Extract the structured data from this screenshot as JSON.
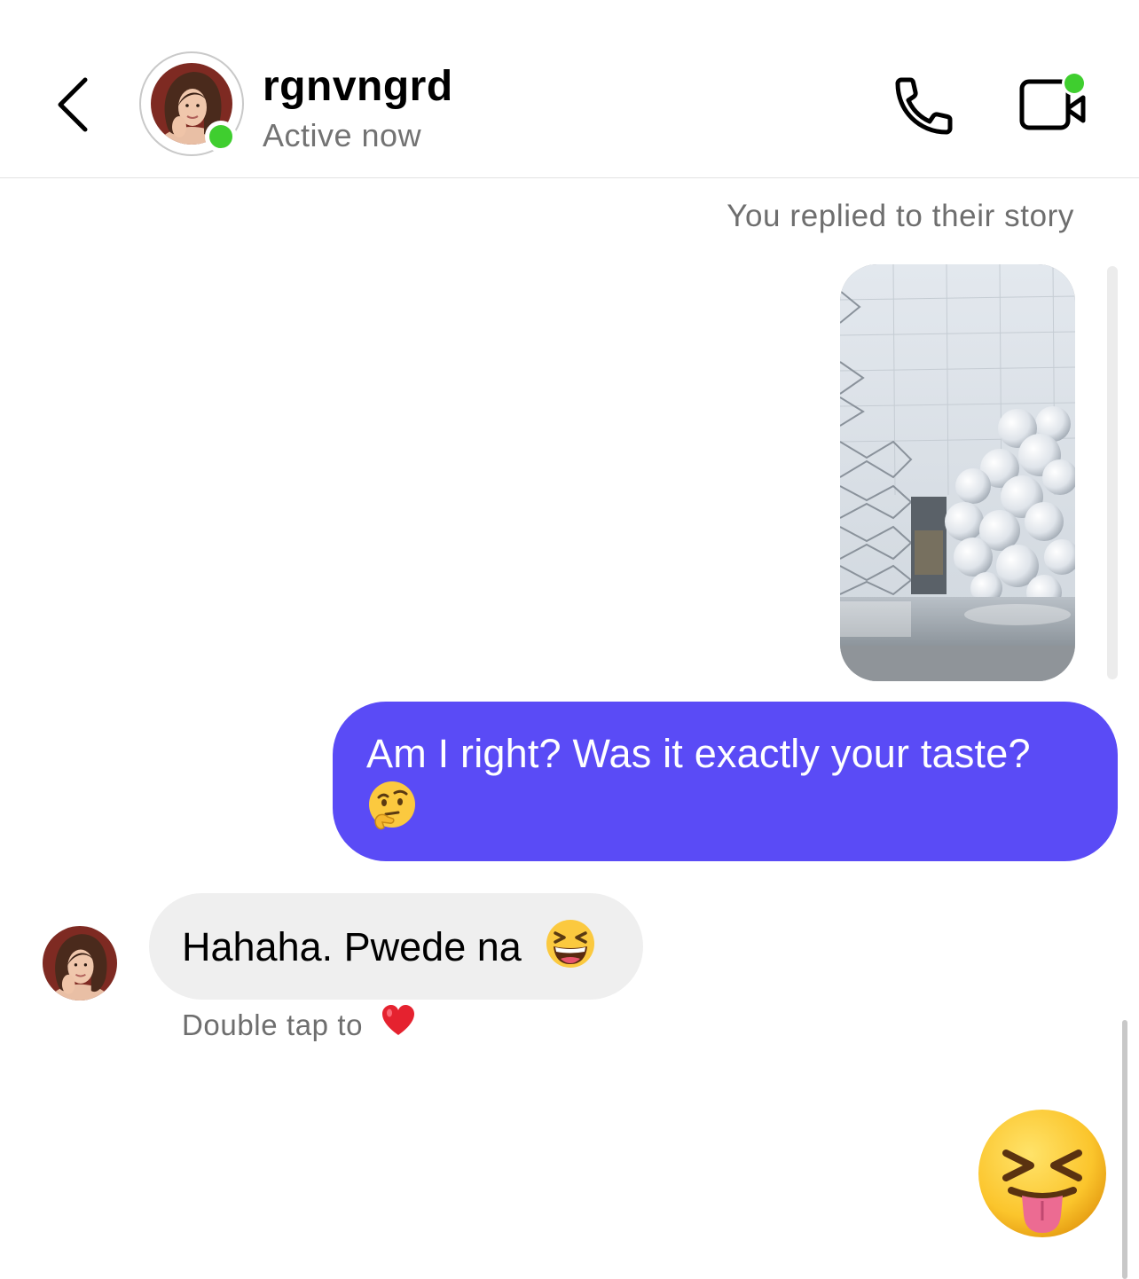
{
  "header": {
    "username": "rgnvngrd",
    "status": "Active now",
    "back_icon": "chevron-left-icon",
    "call_icon": "phone-icon",
    "video_icon": "video-camera-icon",
    "online_color": "#3fce2f"
  },
  "thread": {
    "story_note": "You replied to their story",
    "outgoing_message": "Am I right? Was it exactly your taste?",
    "outgoing_emoji": "thinking-face-icon",
    "outgoing_color": "#5a4bf6",
    "incoming_message": "Hahaha. Pwede na",
    "incoming_emoji": "grinning-squinting-face-icon",
    "double_tap_hint": "Double tap to",
    "double_tap_icon": "red-heart-icon",
    "large_emoji": "squinting-face-with-tongue-icon"
  }
}
